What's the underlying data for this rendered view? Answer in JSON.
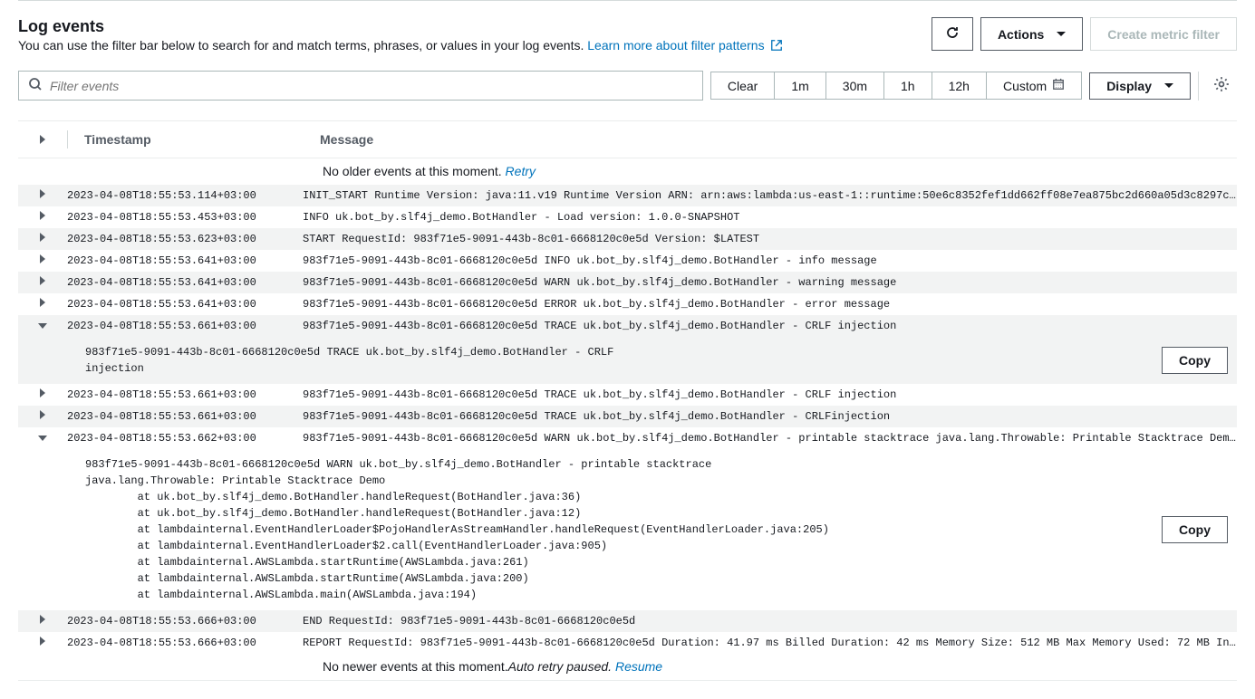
{
  "header": {
    "title": "Log events",
    "description": "You can use the filter bar below to search for and match terms, phrases, or values in your log events.",
    "link_text": "Learn more about filter patterns"
  },
  "buttons": {
    "actions": "Actions",
    "create_metric_filter": "Create metric filter",
    "display": "Display",
    "copy": "Copy"
  },
  "filter": {
    "placeholder": "Filter events",
    "clear": "Clear",
    "t1m": "1m",
    "t30m": "30m",
    "t1h": "1h",
    "t12h": "12h",
    "custom": "Custom"
  },
  "table": {
    "col_timestamp": "Timestamp",
    "col_message": "Message"
  },
  "status_older": "No older events at this moment.",
  "retry": "Retry",
  "status_newer_prefix": "No newer events at this moment. ",
  "status_paused": "Auto retry paused.",
  "resume": "Resume",
  "rows": [
    {
      "ts": "2023-04-08T18:55:53.114+03:00",
      "msg": "INIT_START Runtime Version: java:11.v19 Runtime Version ARN: arn:aws:lambda:us-east-1::runtime:50e6c8352fef1dd662ff08e7ea875bc2d660a05d3c8297c4…"
    },
    {
      "ts": "2023-04-08T18:55:53.453+03:00",
      "msg": "INFO uk.bot_by.slf4j_demo.BotHandler - Load version: 1.0.0-SNAPSHOT"
    },
    {
      "ts": "2023-04-08T18:55:53.623+03:00",
      "msg": "START RequestId: 983f71e5-9091-443b-8c01-6668120c0e5d Version: $LATEST"
    },
    {
      "ts": "2023-04-08T18:55:53.641+03:00",
      "msg": "983f71e5-9091-443b-8c01-6668120c0e5d INFO uk.bot_by.slf4j_demo.BotHandler - info message"
    },
    {
      "ts": "2023-04-08T18:55:53.641+03:00",
      "msg": "983f71e5-9091-443b-8c01-6668120c0e5d WARN uk.bot_by.slf4j_demo.BotHandler - warning message"
    },
    {
      "ts": "2023-04-08T18:55:53.641+03:00",
      "msg": "983f71e5-9091-443b-8c01-6668120c0e5d ERROR uk.bot_by.slf4j_demo.BotHandler - error message"
    },
    {
      "ts": "2023-04-08T18:55:53.661+03:00",
      "msg": "983f71e5-9091-443b-8c01-6668120c0e5d TRACE uk.bot_by.slf4j_demo.BotHandler - CRLF injection",
      "expanded": true,
      "full": "983f71e5-9091-443b-8c01-6668120c0e5d TRACE uk.bot_by.slf4j_demo.BotHandler - CRLF\ninjection"
    },
    {
      "ts": "2023-04-08T18:55:53.661+03:00",
      "msg": "983f71e5-9091-443b-8c01-6668120c0e5d TRACE uk.bot_by.slf4j_demo.BotHandler - CRLF injection"
    },
    {
      "ts": "2023-04-08T18:55:53.661+03:00",
      "msg": "983f71e5-9091-443b-8c01-6668120c0e5d TRACE uk.bot_by.slf4j_demo.BotHandler - CRLFinjection"
    },
    {
      "ts": "2023-04-08T18:55:53.662+03:00",
      "msg": "983f71e5-9091-443b-8c01-6668120c0e5d WARN uk.bot_by.slf4j_demo.BotHandler - printable stacktrace java.lang.Throwable: Printable Stacktrace Dem…",
      "expanded": true,
      "full": "983f71e5-9091-443b-8c01-6668120c0e5d WARN uk.bot_by.slf4j_demo.BotHandler - printable stacktrace\njava.lang.Throwable: Printable Stacktrace Demo\n        at uk.bot_by.slf4j_demo.BotHandler.handleRequest(BotHandler.java:36)\n        at uk.bot_by.slf4j_demo.BotHandler.handleRequest(BotHandler.java:12)\n        at lambdainternal.EventHandlerLoader$PojoHandlerAsStreamHandler.handleRequest(EventHandlerLoader.java:205)\n        at lambdainternal.EventHandlerLoader$2.call(EventHandlerLoader.java:905)\n        at lambdainternal.AWSLambda.startRuntime(AWSLambda.java:261)\n        at lambdainternal.AWSLambda.startRuntime(AWSLambda.java:200)\n        at lambdainternal.AWSLambda.main(AWSLambda.java:194)"
    },
    {
      "ts": "2023-04-08T18:55:53.666+03:00",
      "msg": "END RequestId: 983f71e5-9091-443b-8c01-6668120c0e5d"
    },
    {
      "ts": "2023-04-08T18:55:53.666+03:00",
      "msg": "REPORT RequestId: 983f71e5-9091-443b-8c01-6668120c0e5d Duration: 41.97 ms Billed Duration: 42 ms Memory Size: 512 MB Max Memory Used: 72 MB In…"
    }
  ]
}
